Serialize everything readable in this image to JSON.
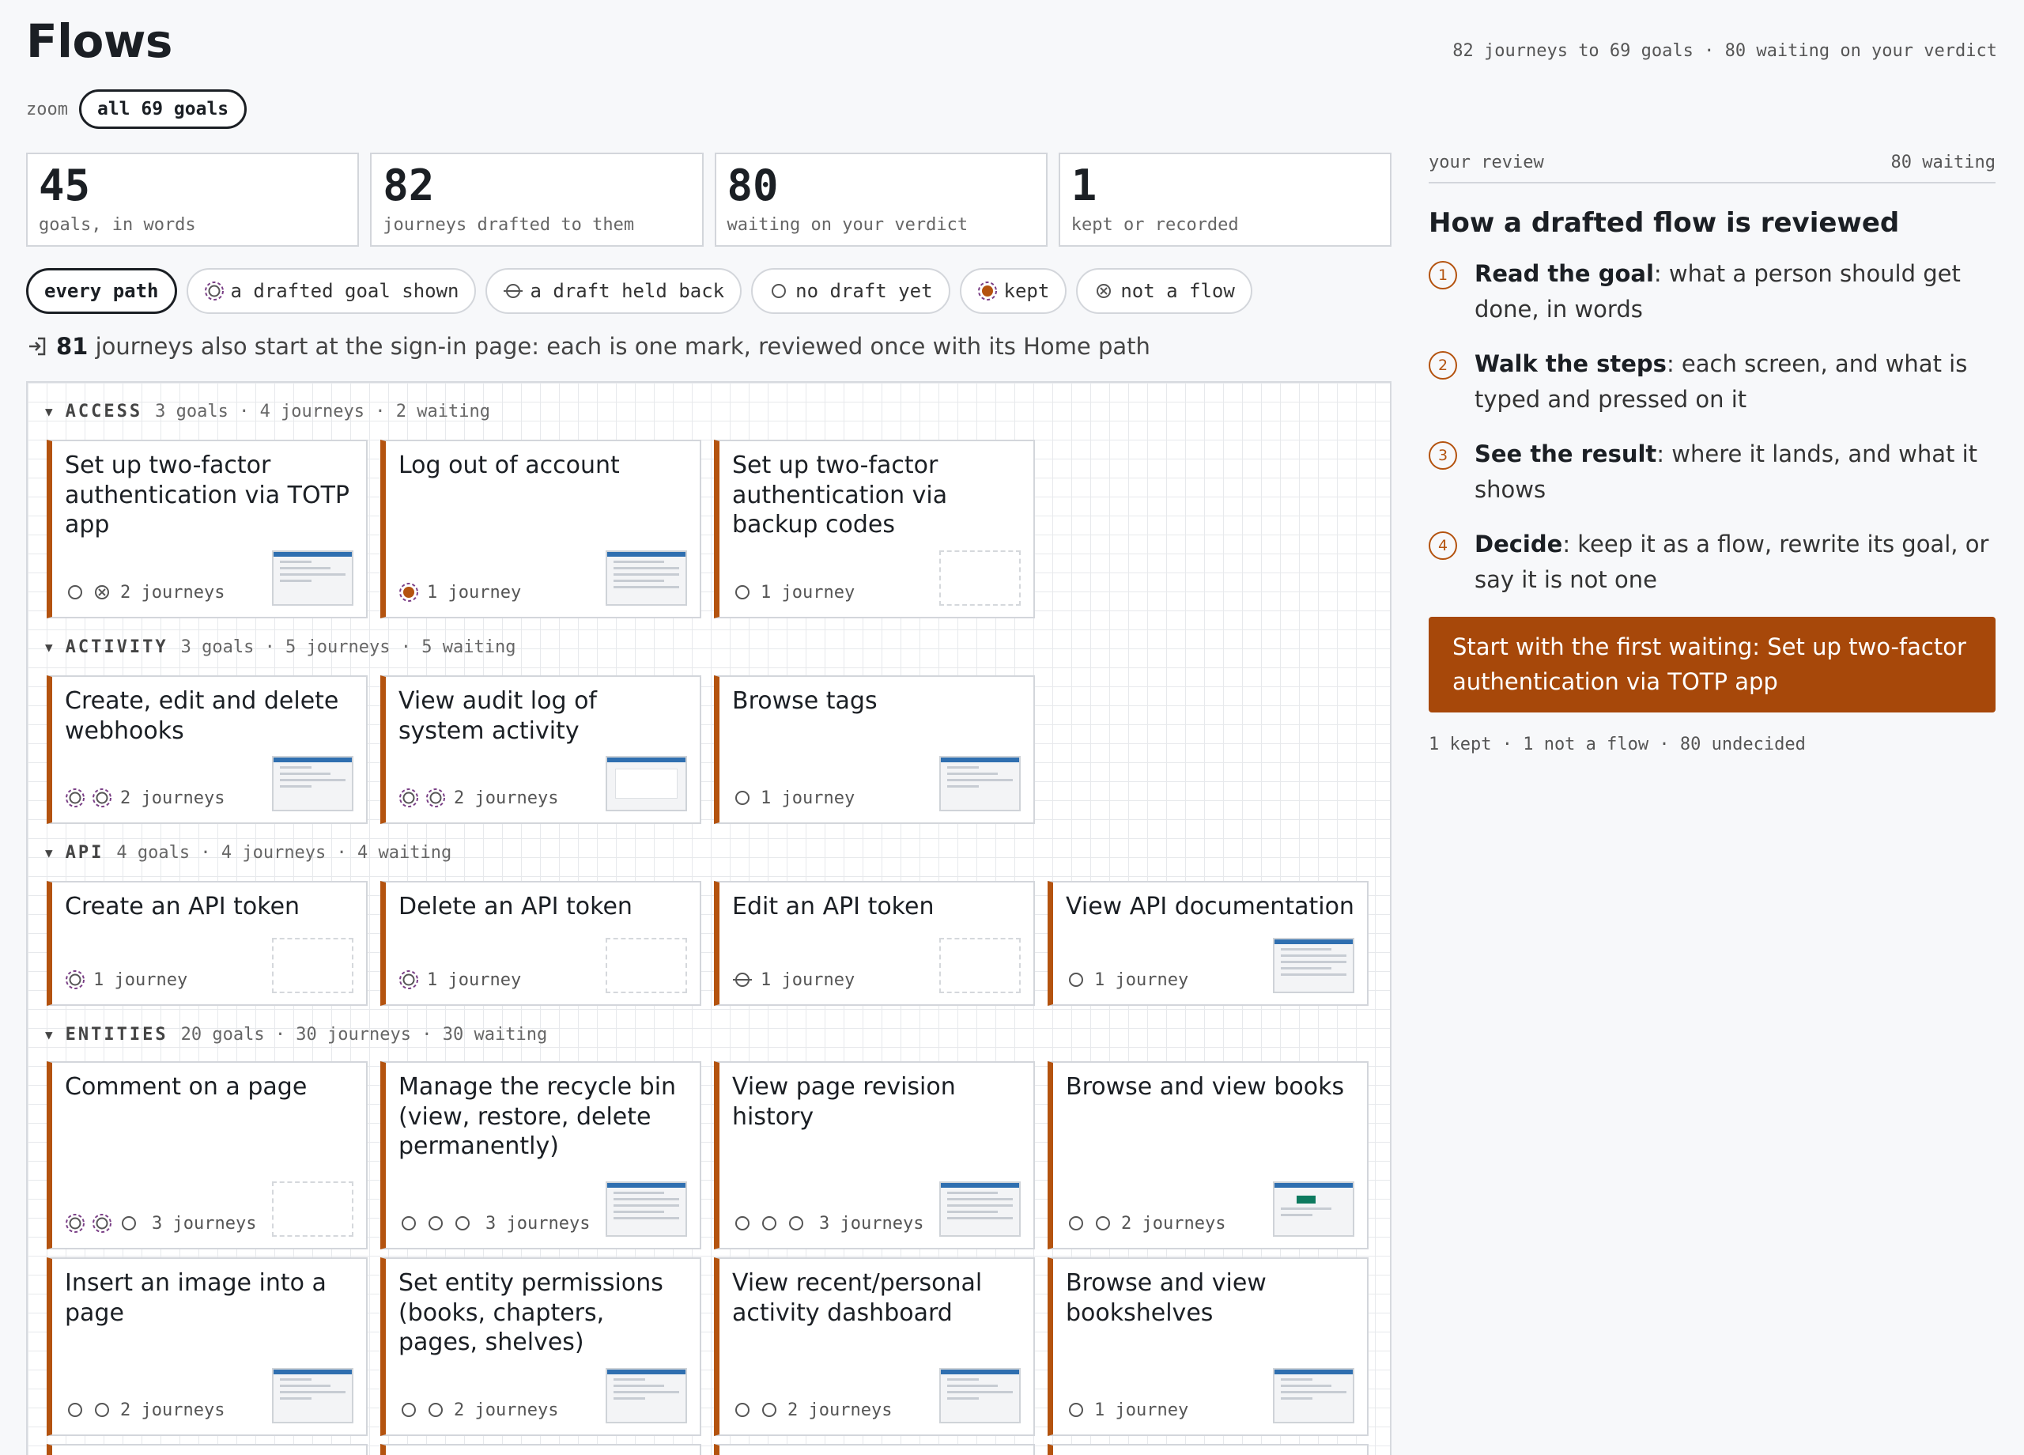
{
  "header": {
    "title": "Flows",
    "summary": "82 journeys to 69 goals · 80 waiting on your verdict",
    "zoom_label": "zoom",
    "zoom_value": "all 69 goals"
  },
  "stats": [
    {
      "value": "45",
      "caption": "goals, in words"
    },
    {
      "value": "82",
      "caption": "journeys drafted to them"
    },
    {
      "value": "80",
      "caption": "waiting on your verdict"
    },
    {
      "value": "1",
      "caption": "kept or recorded"
    }
  ],
  "filters": [
    {
      "label": "every path",
      "icon": "none",
      "active": true
    },
    {
      "label": "a drafted goal shown",
      "icon": "drafted-icon"
    },
    {
      "label": "a draft held back",
      "icon": "held-back-icon"
    },
    {
      "label": "no draft yet",
      "icon": "no-draft-icon"
    },
    {
      "label": "kept",
      "icon": "kept-icon"
    },
    {
      "label": "not a flow",
      "icon": "not-flow-icon"
    }
  ],
  "signin_note": {
    "count": "81",
    "text": "journeys also start at the sign-in page: each is one mark, reviewed once with its Home path"
  },
  "groups": [
    {
      "name": "ACCESS",
      "meta": "3 goals · 4 journeys · 2 waiting"
    },
    {
      "name": "ACTIVITY",
      "meta": "3 goals · 5 journeys · 5 waiting"
    },
    {
      "name": "API",
      "meta": "4 goals · 4 journeys · 4 waiting"
    },
    {
      "name": "ENTITIES",
      "meta": "20 goals · 30 journeys · 30 waiting"
    }
  ],
  "cards": [
    {
      "title": "Set up two-factor authentication via TOTP app",
      "count": "2 journeys",
      "marks": [
        "none",
        "notflow"
      ]
    },
    {
      "title": "Log out of account",
      "count": "1 journey",
      "marks": [
        "kept"
      ]
    },
    {
      "title": "Set up two-factor authentication via backup codes",
      "count": "1 journey",
      "marks": [
        "none"
      ]
    },
    {
      "title": "Create, edit and delete webhooks",
      "count": "2 journeys",
      "marks": [
        "drafted",
        "drafted"
      ]
    },
    {
      "title": "View audit log of system activity",
      "count": "2 journeys",
      "marks": [
        "drafted",
        "drafted"
      ]
    },
    {
      "title": "Browse tags",
      "count": "1 journey",
      "marks": [
        "none"
      ]
    },
    {
      "title": "Create an API token",
      "count": "1 journey",
      "marks": [
        "drafted"
      ]
    },
    {
      "title": "Delete an API token",
      "count": "1 journey",
      "marks": [
        "drafted"
      ]
    },
    {
      "title": "Edit an API token",
      "count": "1 journey",
      "marks": [
        "held"
      ]
    },
    {
      "title": "View API documentation",
      "count": "1 journey",
      "marks": [
        "none"
      ]
    },
    {
      "title": "Comment on a page",
      "count": "3 journeys",
      "marks": [
        "drafted",
        "drafted",
        "none"
      ]
    },
    {
      "title": "Manage the recycle bin (view, restore, delete permanently)",
      "count": "3 journeys",
      "marks": [
        "none",
        "none",
        "none"
      ]
    },
    {
      "title": "View page revision history",
      "count": "3 journeys",
      "marks": [
        "none",
        "none",
        "none"
      ]
    },
    {
      "title": "Browse and view books",
      "count": "2 journeys",
      "marks": [
        "none",
        "none"
      ]
    },
    {
      "title": "Insert an image into a page",
      "count": "2 journeys",
      "marks": [
        "none",
        "none"
      ]
    },
    {
      "title": "Set entity permissions (books, chapters, pages, shelves)",
      "count": "2 journeys",
      "marks": [
        "none",
        "none"
      ]
    },
    {
      "title": "View recent/personal activity dashboard",
      "count": "2 journeys",
      "marks": [
        "none",
        "none"
      ]
    },
    {
      "title": "Browse and view bookshelves",
      "count": "1 journey",
      "marks": [
        "none"
      ]
    }
  ],
  "review": {
    "label": "your review",
    "waiting": "80 waiting",
    "heading": "How a drafted flow is reviewed",
    "steps": [
      {
        "n": "1",
        "bold": "Read the goal",
        "text": ": what a person should get done, in words"
      },
      {
        "n": "2",
        "bold": "Walk the steps",
        "text": ": each screen, and what is typed and pressed on it"
      },
      {
        "n": "3",
        "bold": "See the result",
        "text": ": where it lands, and what it shows"
      },
      {
        "n": "4",
        "bold": "Decide",
        "text": ": keep it as a flow, rewrite its goal, or say it is not one"
      }
    ],
    "start_button": "Start with the first waiting: Set up two-factor authentication via TOTP app",
    "tally": "1 kept · 1 not a flow · 80 undecided"
  },
  "colors": {
    "accent": "#b4530f",
    "button": "#a7480a",
    "drafted": "#7a3f86"
  }
}
